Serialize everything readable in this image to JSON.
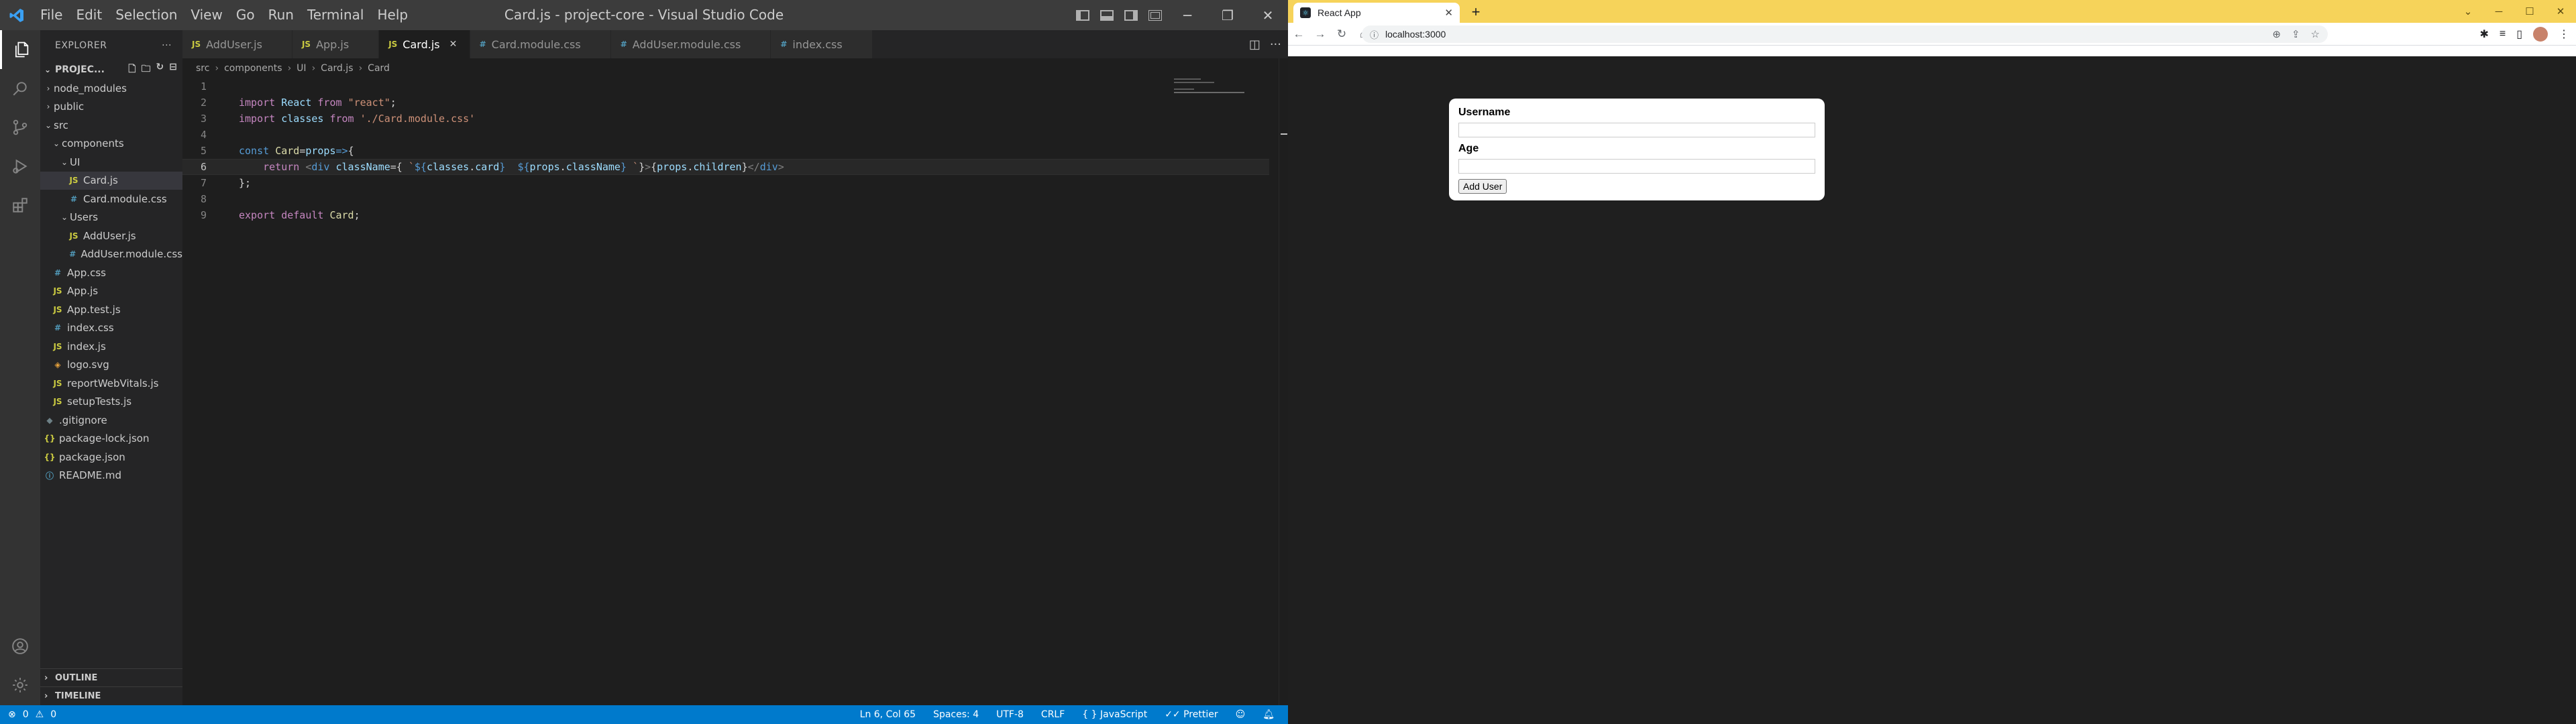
{
  "vscode": {
    "window_title": "Card.js - project-core - Visual Studio Code",
    "menu": [
      "File",
      "Edit",
      "Selection",
      "View",
      "Go",
      "Run",
      "Terminal",
      "Help"
    ],
    "explorer": {
      "header": "EXPLORER",
      "project": "PROJEC...",
      "tree": [
        {
          "label": "node_modules",
          "type": "folder",
          "depth": 1,
          "expanded": false,
          "icon": "chevron-right"
        },
        {
          "label": "public",
          "type": "folder",
          "depth": 1,
          "expanded": false,
          "icon": "chevron-right"
        },
        {
          "label": "src",
          "type": "folder",
          "depth": 1,
          "expanded": true,
          "icon": "chevron-down"
        },
        {
          "label": "components",
          "type": "folder",
          "depth": 2,
          "expanded": true,
          "icon": "chevron-down"
        },
        {
          "label": "UI",
          "type": "folder",
          "depth": 3,
          "expanded": true,
          "icon": "chevron-down"
        },
        {
          "label": "Card.js",
          "type": "js",
          "depth": 4,
          "selected": true,
          "icon": "JS"
        },
        {
          "label": "Card.module.css",
          "type": "css",
          "depth": 4,
          "icon": "#"
        },
        {
          "label": "Users",
          "type": "folder",
          "depth": 3,
          "expanded": true,
          "icon": "chevron-down"
        },
        {
          "label": "AddUser.js",
          "type": "js",
          "depth": 4,
          "icon": "JS"
        },
        {
          "label": "AddUser.module.css",
          "type": "css",
          "depth": 4,
          "icon": "#"
        },
        {
          "label": "App.css",
          "type": "css",
          "depth": 2,
          "icon": "#"
        },
        {
          "label": "App.js",
          "type": "js",
          "depth": 2,
          "icon": "JS"
        },
        {
          "label": "App.test.js",
          "type": "js",
          "depth": 2,
          "icon": "JS"
        },
        {
          "label": "index.css",
          "type": "css",
          "depth": 2,
          "icon": "#"
        },
        {
          "label": "index.js",
          "type": "js",
          "depth": 2,
          "icon": "JS"
        },
        {
          "label": "logo.svg",
          "type": "svg",
          "depth": 2,
          "icon": "◈"
        },
        {
          "label": "reportWebVitals.js",
          "type": "js",
          "depth": 2,
          "icon": "JS"
        },
        {
          "label": "setupTests.js",
          "type": "js",
          "depth": 2,
          "icon": "JS"
        },
        {
          "label": ".gitignore",
          "type": "git",
          "depth": 1,
          "icon": "◆"
        },
        {
          "label": "package-lock.json",
          "type": "json",
          "depth": 1,
          "icon": "{}"
        },
        {
          "label": "package.json",
          "type": "json",
          "depth": 1,
          "icon": "{}"
        },
        {
          "label": "README.md",
          "type": "md",
          "depth": 1,
          "icon": "ⓘ"
        }
      ],
      "outline": "OUTLINE",
      "timeline": "TIMELINE"
    },
    "tabs": [
      {
        "label": "AddUser.js",
        "icon": "JS",
        "type": "js",
        "active": false
      },
      {
        "label": "App.js",
        "icon": "JS",
        "type": "js",
        "active": false
      },
      {
        "label": "Card.js",
        "icon": "JS",
        "type": "js",
        "active": true
      },
      {
        "label": "Card.module.css",
        "icon": "#",
        "type": "css",
        "active": false
      },
      {
        "label": "AddUser.module.css",
        "icon": "#",
        "type": "css",
        "active": false
      },
      {
        "label": "index.css",
        "icon": "#",
        "type": "css",
        "active": false
      }
    ],
    "breadcrumb": [
      "src",
      "components",
      "UI",
      "Card.js",
      "Card"
    ],
    "code_lines": [
      {
        "n": "1",
        "html": ""
      },
      {
        "n": "2",
        "html": "<span class=\"kw\">import</span> <span class=\"var\">React</span> <span class=\"kw\">from</span> <span class=\"str\">\"react\"</span>;"
      },
      {
        "n": "3",
        "html": "<span class=\"kw\">import</span> <span class=\"var\">classes</span> <span class=\"kw\">from</span> <span class=\"str\">'./Card.module.css'</span>"
      },
      {
        "n": "4",
        "html": ""
      },
      {
        "n": "5",
        "html": "<span class=\"kb\">const</span> <span class=\"fn\">Card</span>=<span class=\"var\">props</span><span class=\"kb\">=&gt;</span>{"
      },
      {
        "n": "6",
        "html": "    <span class=\"kw\">return</span> <span class=\"gray\">&lt;</span><span class=\"tag\">div</span> <span class=\"attr\">className</span>={ <span class=\"tmpl\">`</span><span class=\"tmpl-expr\">${</span><span class=\"var\">classes</span>.<span class=\"var\">card</span><span class=\"tmpl-expr\">}</span>  <span class=\"tmpl-expr\">${</span><span class=\"var\">props</span>.<span class=\"var\">className</span><span class=\"tmpl-expr\">}</span> <span class=\"tmpl\">`</span>}<span class=\"gray\">&gt;</span>{<span class=\"var\">props</span>.<span class=\"var\">children</span>}<span class=\"gray\">&lt;/</span><span class=\"tag\">div</span><span class=\"gray\">&gt;</span>",
        "current": true
      },
      {
        "n": "7",
        "html": "};"
      },
      {
        "n": "8",
        "html": ""
      },
      {
        "n": "9",
        "html": "<span class=\"kw\">export</span> <span class=\"kw\">default</span> <span class=\"fn\">Card</span>;"
      }
    ],
    "status": {
      "errors": "0",
      "warnings": "0",
      "position": "Ln 6, Col 65",
      "spaces": "Spaces: 4",
      "encoding": "UTF-8",
      "eol": "CRLF",
      "language": "JavaScript",
      "formatter": "Prettier"
    },
    "colors": {
      "statusbar": "#007acc",
      "activity": "#333333"
    }
  },
  "chrome": {
    "tab_title": "React App",
    "url": "localhost:3000",
    "tabstrip_color": "#f6d35a"
  },
  "app": {
    "username_label": "Username",
    "age_label": "Age",
    "username_value": "",
    "age_value": "",
    "submit_label": "Add User"
  }
}
